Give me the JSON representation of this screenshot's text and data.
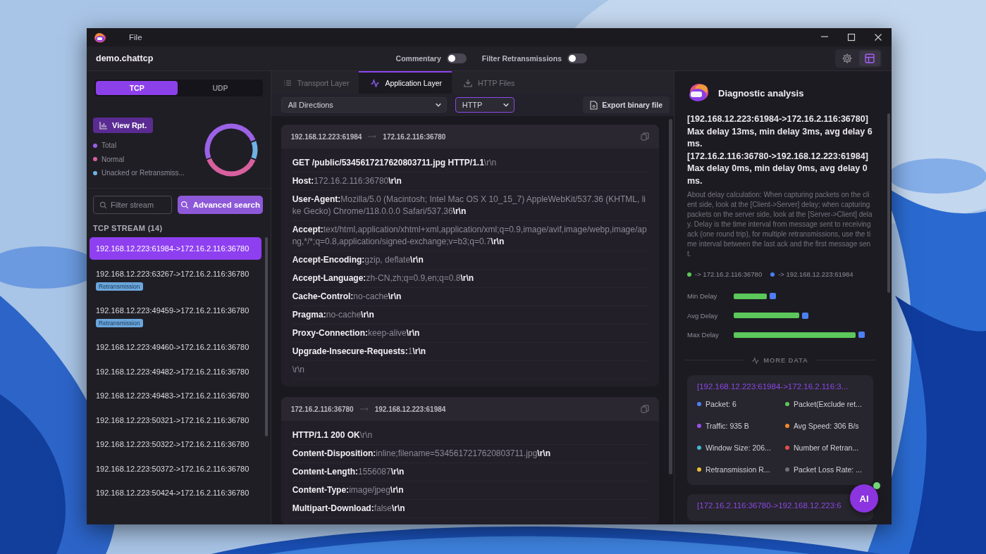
{
  "window": {
    "menu": [
      "File"
    ],
    "title": "demo.chattcp",
    "toggles": [
      {
        "label": "Commentary",
        "on": false
      },
      {
        "label": "Filter Retransmissions",
        "on": false
      }
    ],
    "tool_buttons": [
      {
        "selected": false
      },
      {
        "selected": true
      }
    ]
  },
  "sidebar": {
    "protocol_tabs": [
      {
        "label": "TCP",
        "selected": true
      },
      {
        "label": "UDP",
        "selected": false
      }
    ],
    "report_button": "View Rpt.",
    "legend": [
      {
        "label": "Total",
        "color": "#9b62e6"
      },
      {
        "label": "Normal",
        "color": "#d8609f"
      },
      {
        "label": "Unacked or Retransmiss...",
        "color": "#6fb2e3"
      }
    ],
    "filter": {
      "placeholder": "Filter stream"
    },
    "search_button": "Advanced search",
    "stream_heading": "TCP STREAM (14)",
    "streams": [
      {
        "label": "192.168.12.223:61984->172.16.2.116:36780",
        "selected": true
      },
      {
        "label": "192.168.12.223:63267->172.16.2.116:36780",
        "selected": false,
        "tag": "Retransmission"
      },
      {
        "label": "192.168.12.223:49459->172.16.2.116:36780",
        "selected": false,
        "tag": "Retransmission"
      },
      {
        "label": "192.168.12.223:49460->172.16.2.116:36780",
        "selected": false
      },
      {
        "label": "192.168.12.223:49482->172.16.2.116:36780",
        "selected": false
      },
      {
        "label": "192.168.12.223:49483->172.16.2.116:36780",
        "selected": false
      },
      {
        "label": "192.168.12.223:50321->172.16.2.116:36780",
        "selected": false
      },
      {
        "label": "192.168.12.223:50322->172.16.2.116:36780",
        "selected": false
      },
      {
        "label": "192.168.12.223:50372->172.16.2.116:36780",
        "selected": false
      },
      {
        "label": "192.168.12.223:50424->172.16.2.116:36780",
        "selected": false
      }
    ]
  },
  "main": {
    "tabs": [
      {
        "label": "Transport Layer",
        "selected": false
      },
      {
        "label": "Application Layer",
        "selected": true
      },
      {
        "label": "HTTP Files",
        "selected": false
      }
    ],
    "direction_select": {
      "value": "All Directions"
    },
    "protocol_select": {
      "value": "HTTP"
    },
    "export_button": "Export binary file",
    "messages": [
      {
        "source": "192.168.12.223:61984",
        "destination": "172.16.2.116:36780",
        "lines": [
          [
            {
              "text": "GET /public/5345617217620803711.jpg HTTP/1.1",
              "kind": "key"
            },
            {
              "text": "\\r\\n",
              "kind": "value"
            }
          ],
          [
            {
              "text": "Host:",
              "kind": "key"
            },
            {
              "text": "172.16.2.116:36780",
              "kind": "value"
            },
            {
              "text": "\\r\\n",
              "kind": "key"
            }
          ],
          [
            {
              "text": "User-Agent:",
              "kind": "key"
            },
            {
              "text": "Mozilla/5.0 (Macintosh; Intel Mac OS X 10_15_7) AppleWebKit/537.36 (KHTML, like Gecko) Chrome/118.0.0.0 Safari/537.36",
              "kind": "value"
            },
            {
              "text": "\\r\\n",
              "kind": "key"
            }
          ],
          [
            {
              "text": "Accept:",
              "kind": "key"
            },
            {
              "text": "text/html,application/xhtml+xml,application/xml;q=0.9,image/avif,image/webp,image/apng,*/*;q=0.8,application/signed-exchange;v=b3;q=0.7",
              "kind": "value"
            },
            {
              "text": "\\r\\n",
              "kind": "key"
            }
          ],
          [
            {
              "text": "Accept-Encoding:",
              "kind": "key"
            },
            {
              "text": "gzip, deflate",
              "kind": "value"
            },
            {
              "text": "\\r\\n",
              "kind": "key"
            }
          ],
          [
            {
              "text": "Accept-Language:",
              "kind": "key"
            },
            {
              "text": "zh-CN,zh;q=0.9,en;q=0.8",
              "kind": "value"
            },
            {
              "text": "\\r\\n",
              "kind": "key"
            }
          ],
          [
            {
              "text": "Cache-Control:",
              "kind": "key"
            },
            {
              "text": "no-cache",
              "kind": "value"
            },
            {
              "text": "\\r\\n",
              "kind": "key"
            }
          ],
          [
            {
              "text": "Pragma:",
              "kind": "key"
            },
            {
              "text": "no-cache",
              "kind": "value"
            },
            {
              "text": "\\r\\n",
              "kind": "key"
            }
          ],
          [
            {
              "text": "Proxy-Connection:",
              "kind": "key"
            },
            {
              "text": "keep-alive",
              "kind": "value"
            },
            {
              "text": "\\r\\n",
              "kind": "key"
            }
          ],
          [
            {
              "text": "Upgrade-Insecure-Requests:",
              "kind": "key"
            },
            {
              "text": "1",
              "kind": "value"
            },
            {
              "text": "\\r\\n",
              "kind": "key"
            }
          ],
          [
            {
              "text": "\\r\\n",
              "kind": "value"
            }
          ]
        ]
      },
      {
        "source": "172.16.2.116:36780",
        "destination": "192.168.12.223:61984",
        "lines": [
          [
            {
              "text": "HTTP/1.1 200 OK",
              "kind": "key"
            },
            {
              "text": "\\r\\n",
              "kind": "value"
            }
          ],
          [
            {
              "text": "Content-Disposition:",
              "kind": "key"
            },
            {
              "text": "inline;filename=5345617217620803711.jpg",
              "kind": "value"
            },
            {
              "text": "\\r\\n",
              "kind": "key"
            }
          ],
          [
            {
              "text": "Content-Length:",
              "kind": "key"
            },
            {
              "text": "1556087",
              "kind": "value"
            },
            {
              "text": "\\r\\n",
              "kind": "key"
            }
          ],
          [
            {
              "text": "Content-Type:",
              "kind": "key"
            },
            {
              "text": "image/jpeg",
              "kind": "value"
            },
            {
              "text": "\\r\\n",
              "kind": "key"
            }
          ],
          [
            {
              "text": "Multipart-Download:",
              "kind": "key"
            },
            {
              "text": "false",
              "kind": "value"
            },
            {
              "text": "\\r\\n",
              "kind": "key"
            }
          ]
        ]
      }
    ]
  },
  "diagnostic": {
    "title": "Diagnostic analysis",
    "summary": [
      "[192.168.12.223:61984->172.16.2.116:36780]",
      "Max delay 13ms, min delay 3ms, avg delay 6ms.",
      "[172.16.2.116:36780->192.168.12.223:61984]",
      "Max delay 0ms, min delay 0ms, avg delay 0ms."
    ],
    "note": "About delay calculation: When capturing packets on the client side, look at the [Client->Server] delay; when capturing packets on the server side, look at the [Server->Client] delay. Delay is the time interval from message sent to receiving ack (one round trip), for multiple retransmissions, use the time interval between the last ack and the first message sent.",
    "series": [
      {
        "name": "-> 172.16.2.116:36780",
        "color": "#5cc75a"
      },
      {
        "name": "-> 192.168.12.223:61984",
        "color": "#4d7ff2"
      }
    ],
    "delays": [
      {
        "label": "Min Delay"
      },
      {
        "label": "Avg Delay"
      },
      {
        "label": "Max Delay"
      }
    ],
    "more_label": "MORE DATA",
    "stream_cards": [
      {
        "title": "[192.168.12.223:61984->172.16.2.116:3...",
        "stats": [
          {
            "label": "Packet: 6",
            "color": "#4f7ef5"
          },
          {
            "label": "Packet(Exclude ret...",
            "color": "#5cc75a"
          },
          {
            "label": "Traffic: 935 B",
            "color": "#9a4ef0"
          },
          {
            "label": "Avg Speed: 306 B/s",
            "color": "#f0882e"
          },
          {
            "label": "Window Size: 206...",
            "color": "#45b5d0"
          },
          {
            "label": "Number of Retran...",
            "color": "#e0504a"
          },
          {
            "label": "Retransmission R...",
            "color": "#e8c030"
          },
          {
            "label": "Packet Loss Rate: ...",
            "color": "#707078"
          }
        ]
      },
      {
        "title": "[172.16.2.116:36780->192.168.12.223:6"
      }
    ]
  },
  "ai_button": "AI"
}
